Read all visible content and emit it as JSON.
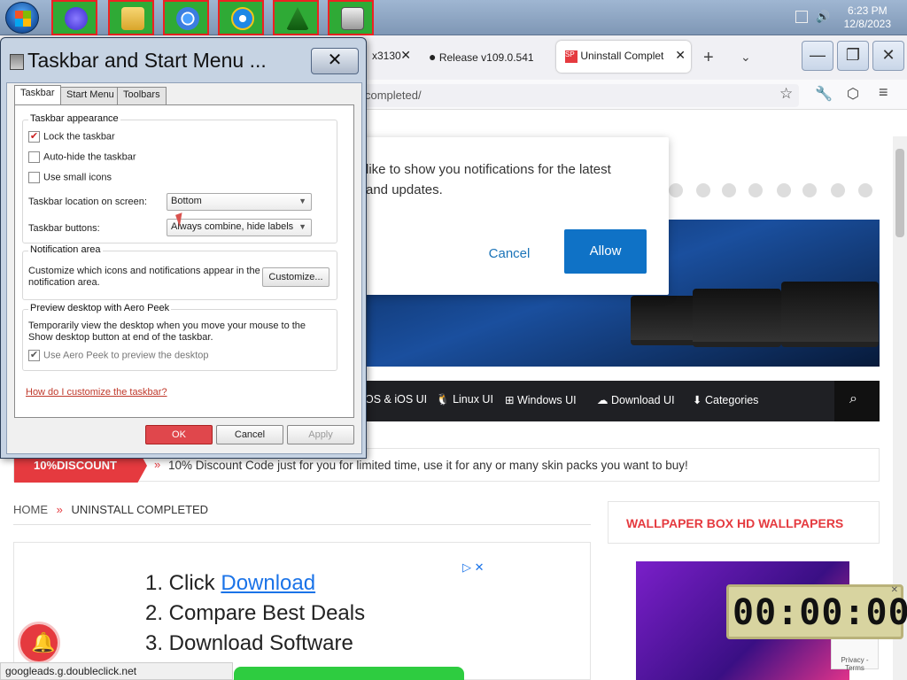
{
  "taskbar": {
    "apps": [
      {
        "icon": "start-orb-icon"
      },
      {
        "icon": "app-blue-circle-icon"
      },
      {
        "icon": "file-explorer-icon"
      },
      {
        "icon": "chrome-icon"
      },
      {
        "icon": "internet-explorer-icon"
      },
      {
        "icon": "christmas-tree-icon"
      },
      {
        "icon": "server-icon"
      }
    ],
    "clock_time": "6:23 PM",
    "clock_date": "12/8/2023"
  },
  "browser": {
    "tabs": [
      {
        "label": "x3130"
      },
      {
        "label": "Release v109.0.541"
      },
      {
        "label": "Uninstall Complet"
      }
    ],
    "url": "completed/",
    "status_url": "googleads.g.doubleclick.net"
  },
  "notification": {
    "line1": "like to show you notifications for the latest",
    "line2": "and updates.",
    "cancel": "Cancel",
    "allow": "Allow"
  },
  "nav": {
    "items": [
      "OS & iOS UI",
      "Linux UI",
      "Windows UI",
      "Download UI",
      "Categories"
    ]
  },
  "discount": {
    "tag": "10%DISCOUNT",
    "text": "10% Discount Code just for you for limited time, use it for any or many skin packs you want to buy!"
  },
  "breadcrumb": {
    "home": "HOME",
    "current": "UNINSTALL COMPLETED"
  },
  "sidebar": {
    "title": "WALLPAPER BOX HD WALLPAPERS"
  },
  "ad": {
    "line1_prefix": "1. Click ",
    "line1_link": "Download",
    "line2": "2. Compare Best Deals",
    "line3": "3. Download Software"
  },
  "timer": {
    "value": "00:00:00"
  },
  "recaptcha": {
    "text": "Privacy - Terms"
  },
  "dialog": {
    "title": "Taskbar and Start Menu ...",
    "tabs": [
      "Taskbar",
      "Start Menu",
      "Toolbars"
    ],
    "appearance": {
      "title": "Taskbar appearance",
      "lock": "Lock the taskbar",
      "lock_checked": true,
      "autohide": "Auto-hide the taskbar",
      "small_icons": "Use small icons",
      "location_label": "Taskbar location on screen:",
      "location_value": "Bottom",
      "buttons_label": "Taskbar buttons:",
      "buttons_value": "Always combine, hide labels"
    },
    "notification_area": {
      "title": "Notification area",
      "desc1": "Customize which icons and notifications appear in the",
      "desc2": "notification area.",
      "customize": "Customize..."
    },
    "aero": {
      "title": "Preview desktop with Aero Peek",
      "desc1": "Temporarily view the desktop when you move your mouse to the",
      "desc2": "Show desktop button at end of the taskbar.",
      "use": "Use Aero Peek to preview the desktop"
    },
    "help_link": "How do I customize the taskbar?",
    "ok": "OK",
    "cancel": "Cancel",
    "apply": "Apply"
  }
}
